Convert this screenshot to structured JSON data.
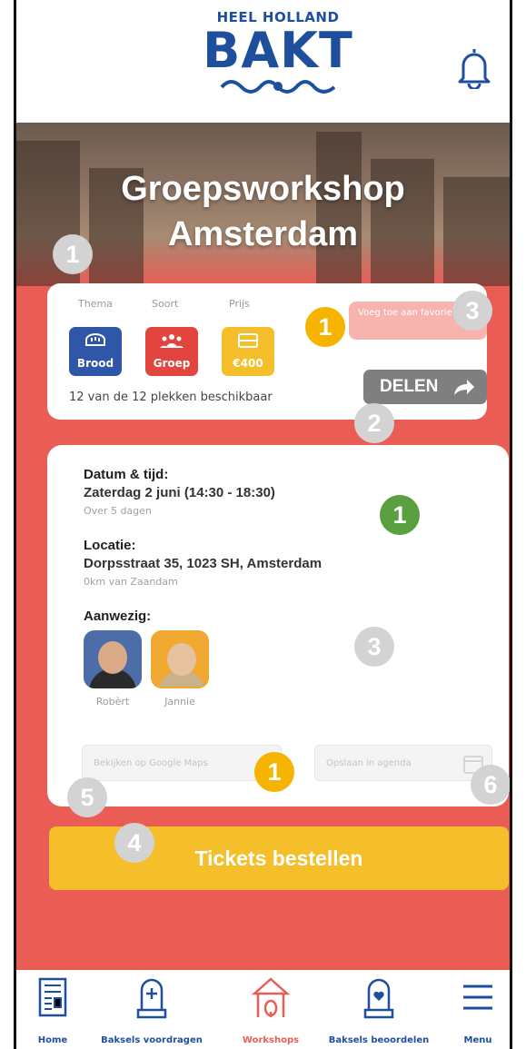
{
  "header": {
    "logo_top": "HEEL HOLLAND",
    "logo_main": "BAKT"
  },
  "hero": {
    "title_line1": "Groepsworkshop",
    "title_line2": "Amsterdam"
  },
  "summary": {
    "columns": [
      {
        "label": "Thema",
        "value": "Brood",
        "color": "#2f56a7",
        "icon": "bread-icon"
      },
      {
        "label": "Soort",
        "value": "Groep",
        "color": "#e2453d",
        "icon": "group-icon"
      },
      {
        "label": "Prijs",
        "value": "€400",
        "color": "#f5be2b",
        "icon": "ticket-icon"
      }
    ],
    "availability": "12 van de 12 plekken beschikbaar",
    "favorite_label": "Voeg toe aan favorieten",
    "share_label": "DELEN"
  },
  "details": {
    "date_label": "Datum & tijd:",
    "date_value": "Zaterdag 2 juni (14:30 - 18:30)",
    "date_sub": "Over 5 dagen",
    "location_label": "Locatie:",
    "location_value": "Dorpsstraat 35, 1023 SH, Amsterdam",
    "location_sub": "0km van Zaandam",
    "present_label": "Aanwezig:",
    "attendees": [
      {
        "name": "Robèrt"
      },
      {
        "name": "Jannie"
      }
    ],
    "maps_button": "Bekijken op Google Maps",
    "calendar_button": "Opslaan in agenda"
  },
  "tickets_button": "Tickets bestellen",
  "markers": {
    "m1_hero": "1",
    "m3_card": "3",
    "m1_yellow_card": "1",
    "m2_share": "2",
    "m1_green": "1",
    "m3_details": "3",
    "m1_yellow_bottom": "1",
    "m5": "5",
    "m6": "6",
    "m4": "4"
  },
  "nav": [
    {
      "label": "Home",
      "icon": "newspaper-icon",
      "active": false
    },
    {
      "label": "Baksels voordragen",
      "icon": "oven-mitt-plus-icon",
      "active": false
    },
    {
      "label": "Workshops",
      "icon": "tent-whisk-icon",
      "active": true
    },
    {
      "label": "Baksels beoordelen",
      "icon": "oven-mitt-heart-icon",
      "active": false
    },
    {
      "label": "Menu",
      "icon": "hamburger-menu-icon",
      "active": false
    }
  ],
  "colors": {
    "brand_blue": "#1e4f9c",
    "coral": "#ea5d55",
    "yellow": "#f5be2b"
  }
}
